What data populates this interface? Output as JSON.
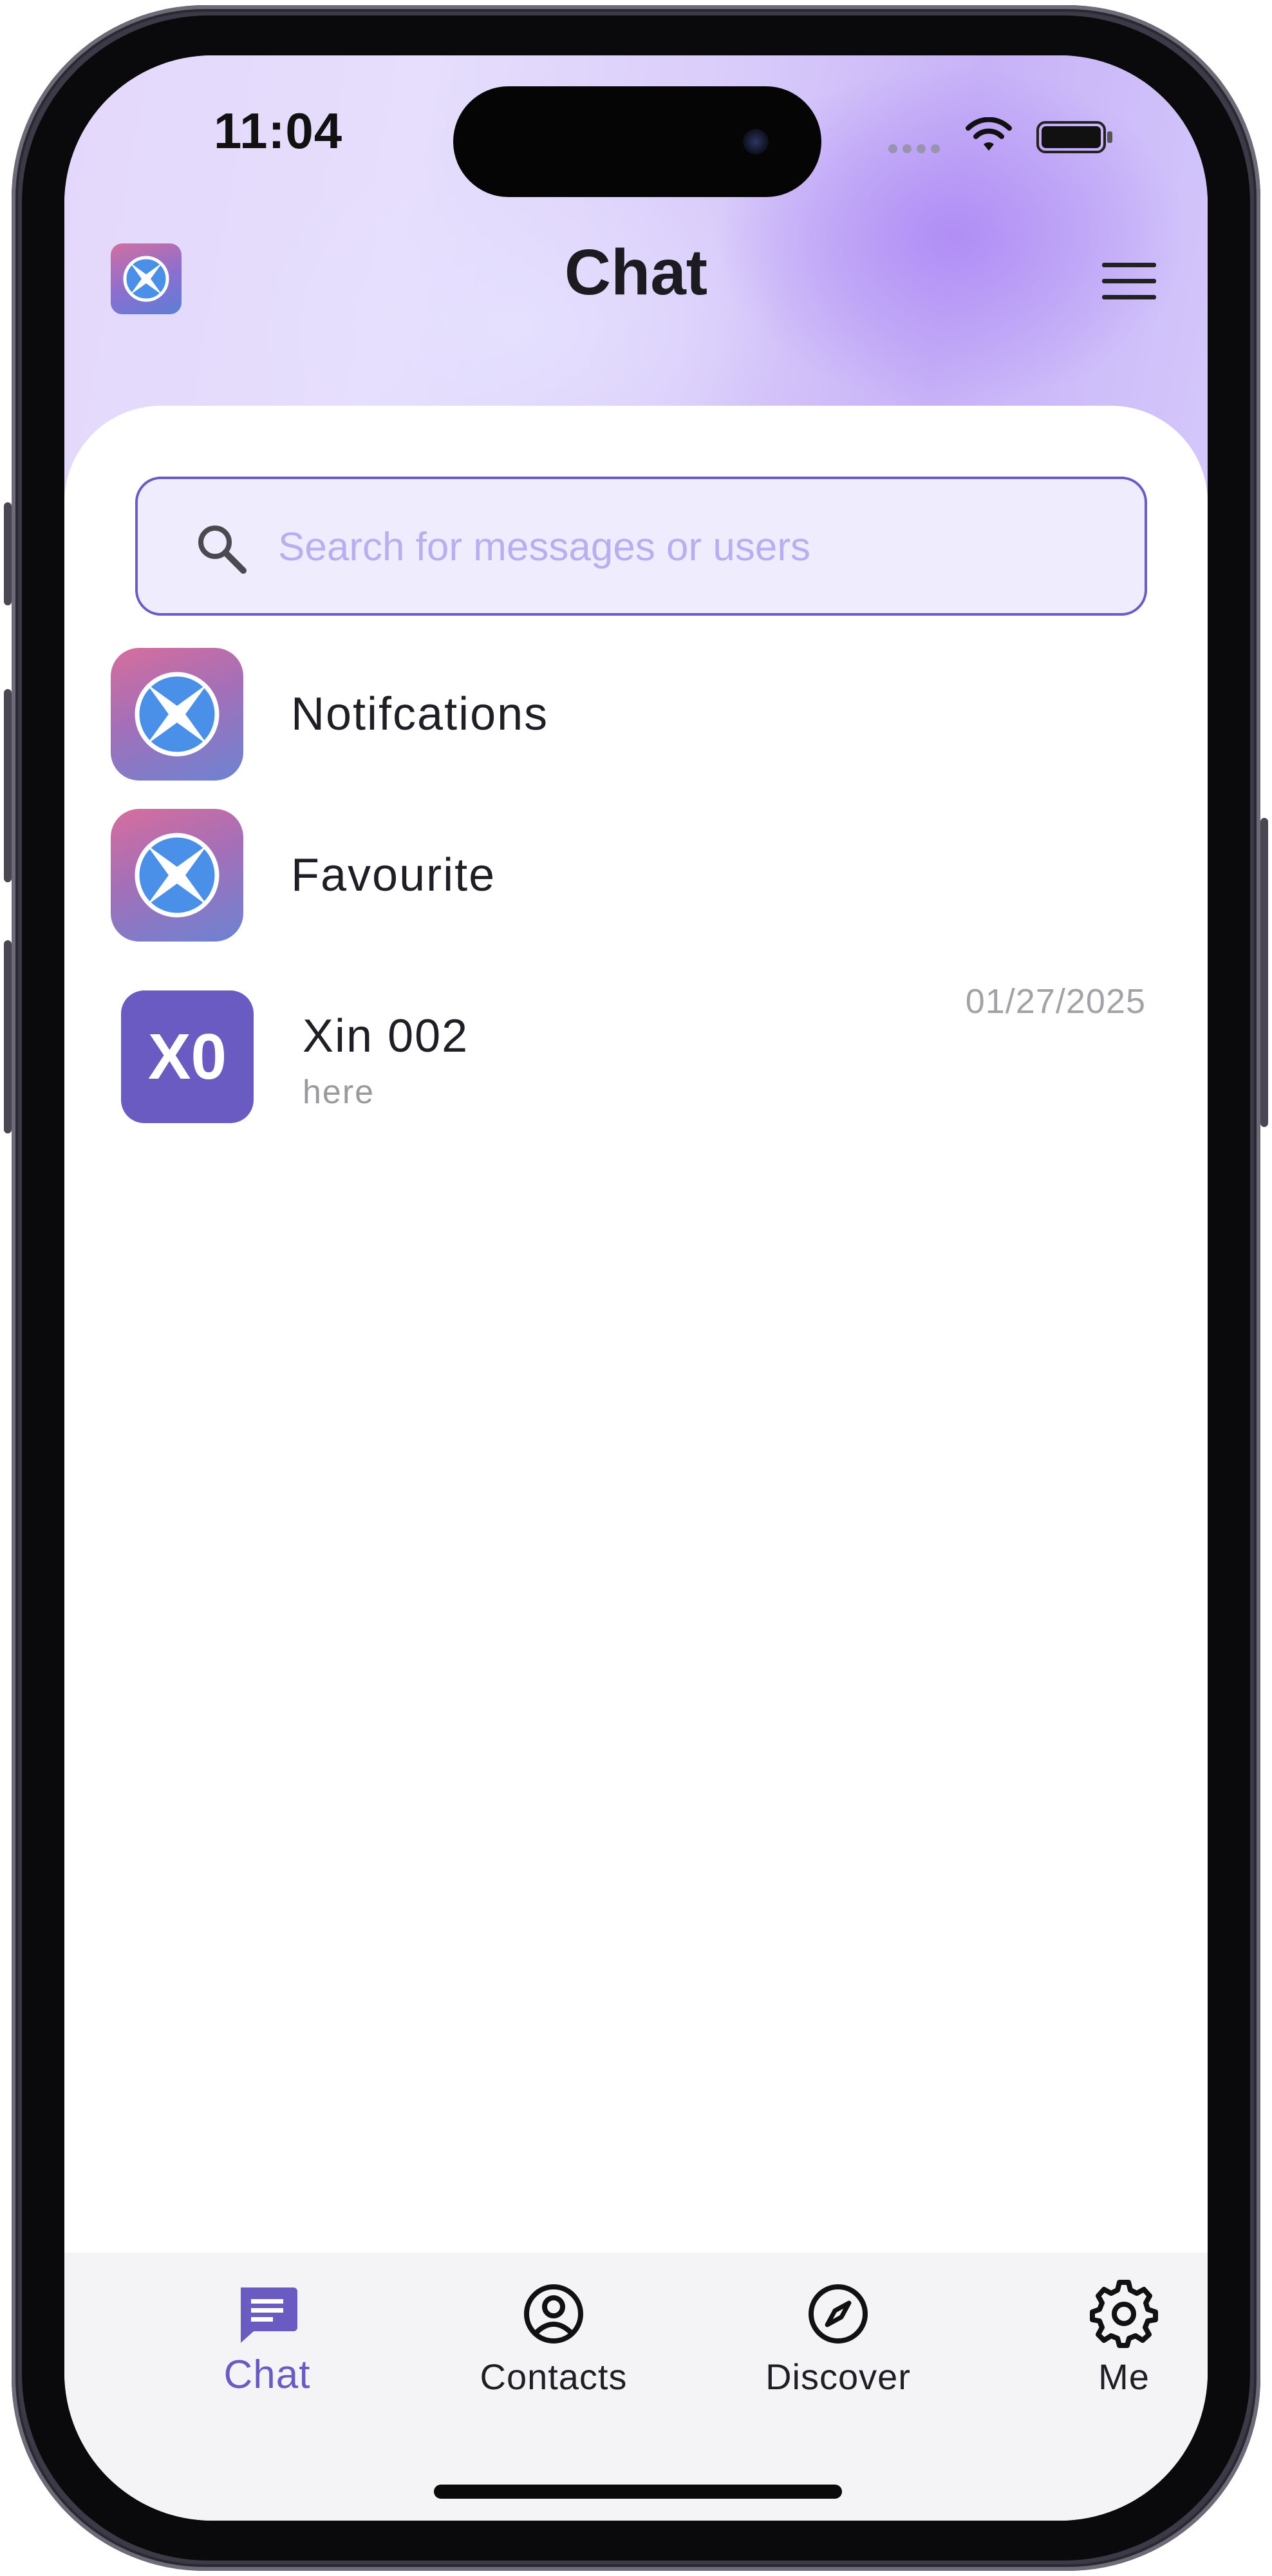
{
  "status_bar": {
    "time": "11:04"
  },
  "header": {
    "title": "Chat"
  },
  "search": {
    "placeholder": "Search for messages or users"
  },
  "list": {
    "system_items": [
      {
        "label": "Notifcations",
        "icon": "app-logo-icon"
      },
      {
        "label": "Favourite",
        "icon": "app-logo-icon"
      }
    ],
    "chats": [
      {
        "avatar_text": "X0",
        "name": "Xin 002",
        "preview": "here",
        "date": "01/27/2025"
      }
    ]
  },
  "tabs": [
    {
      "label": "Chat",
      "icon": "chat-bubble-icon",
      "active": true
    },
    {
      "label": "Contacts",
      "icon": "person-circle-icon",
      "active": false
    },
    {
      "label": "Discover",
      "icon": "compass-icon",
      "active": false
    },
    {
      "label": "Me",
      "icon": "gear-icon",
      "active": false
    }
  ],
  "colors": {
    "accent": "#6a5bc2",
    "search_border": "#6a5cc4",
    "search_bg": "#efedfd",
    "placeholder": "#b9aef0"
  }
}
